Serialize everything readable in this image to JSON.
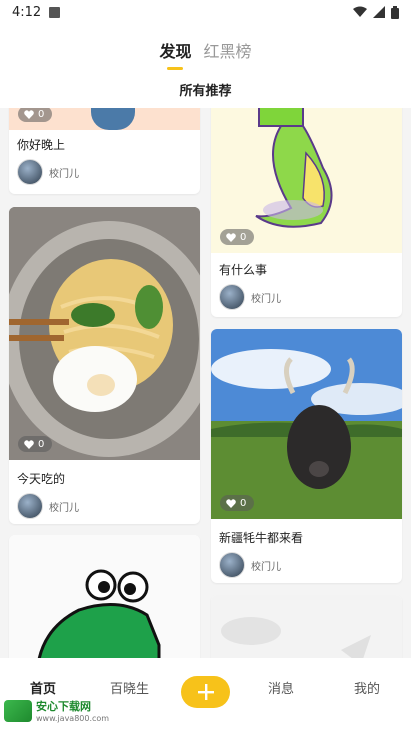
{
  "status": {
    "time": "4:12"
  },
  "tabs": [
    {
      "label": "发现"
    },
    {
      "label": "红黑榜"
    }
  ],
  "subtitle": "所有推荐",
  "cards": [
    {
      "title": "你好晚上",
      "likes": "0",
      "author": "校门儿"
    },
    {
      "title": "有什么事",
      "likes": "0",
      "author": "校门儿"
    },
    {
      "title": "今天吃的",
      "likes": "0",
      "author": "校门儿"
    },
    {
      "title": "新疆牦牛都来看",
      "likes": "0",
      "author": "校门儿"
    }
  ],
  "nav": {
    "home": "首页",
    "baixiao": "百晓生",
    "messages": "消息",
    "mine": "我的"
  },
  "watermark": {
    "name": "安心下载网",
    "url": "www.java800.com"
  },
  "colors": {
    "accent": "#f7c21a"
  }
}
